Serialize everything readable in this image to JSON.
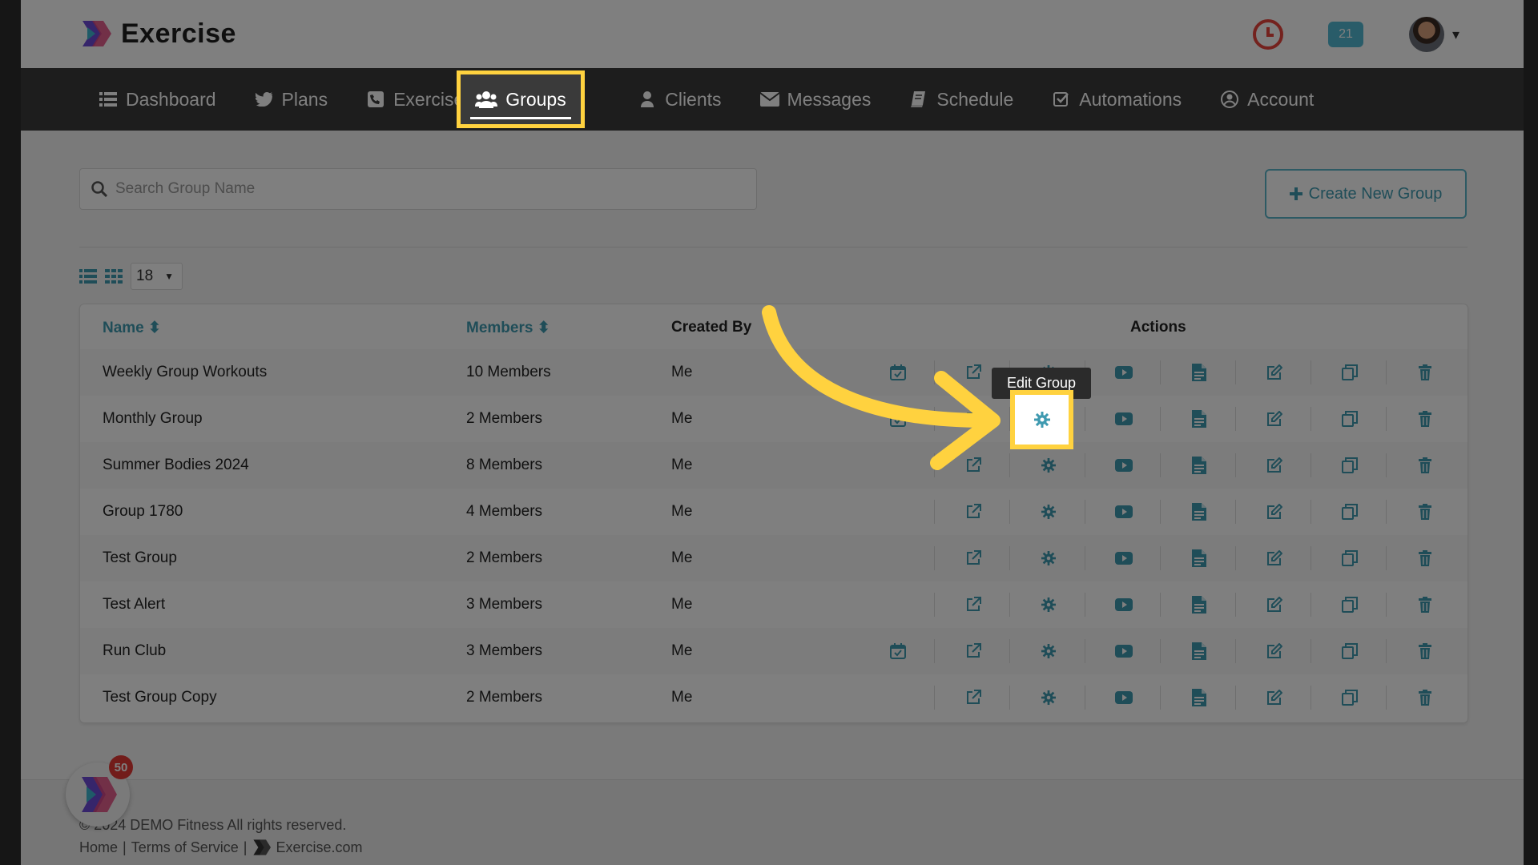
{
  "app": {
    "name": "Exercise",
    "notification_count": "21"
  },
  "nav": {
    "items": [
      {
        "label": "Dashboard",
        "icon": "list-icon"
      },
      {
        "label": "Plans",
        "icon": "bird-icon"
      },
      {
        "label": "Exercises",
        "icon": "phone-square-icon"
      },
      {
        "label": "Groups",
        "icon": "users-icon",
        "active": true
      },
      {
        "label": "Clients",
        "icon": "user-icon"
      },
      {
        "label": "Messages",
        "icon": "envelope-icon"
      },
      {
        "label": "Schedule",
        "icon": "book-icon"
      },
      {
        "label": "Automations",
        "icon": "check-square-icon"
      },
      {
        "label": "Account",
        "icon": "user-circle-icon"
      }
    ]
  },
  "search": {
    "placeholder": "Search Group Name"
  },
  "create_button": {
    "label": "Create New Group"
  },
  "pagination": {
    "per_page": "18"
  },
  "table": {
    "headers": {
      "name": "Name",
      "members": "Members",
      "created_by": "Created By",
      "actions": "Actions"
    },
    "rows": [
      {
        "name": "Weekly Group Workouts",
        "members": "10 Members",
        "created_by": "Me",
        "has_calendar": true
      },
      {
        "name": "Monthly Group",
        "members": "2 Members",
        "created_by": "Me",
        "has_calendar": true
      },
      {
        "name": "Summer Bodies 2024",
        "members": "8 Members",
        "created_by": "Me",
        "has_calendar": false
      },
      {
        "name": "Group 1780",
        "members": "4 Members",
        "created_by": "Me",
        "has_calendar": false
      },
      {
        "name": "Test Group",
        "members": "2 Members",
        "created_by": "Me",
        "has_calendar": false
      },
      {
        "name": "Test Alert",
        "members": "3 Members",
        "created_by": "Me",
        "has_calendar": false
      },
      {
        "name": "Run Club",
        "members": "3 Members",
        "created_by": "Me",
        "has_calendar": true
      },
      {
        "name": "Test Group Copy",
        "members": "2 Members",
        "created_by": "Me",
        "has_calendar": false
      }
    ]
  },
  "tooltip": {
    "text": "Edit Group"
  },
  "chat": {
    "badge": "50"
  },
  "footer": {
    "copyright": "© 2024 DEMO Fitness All rights reserved.",
    "home": "Home",
    "terms": "Terms of Service",
    "site": "Exercise.com"
  },
  "colors": {
    "accent": "#3f9ab0",
    "highlight": "#ffd23f",
    "nav_bg": "#3a3a3a",
    "badge": "#e53935"
  }
}
